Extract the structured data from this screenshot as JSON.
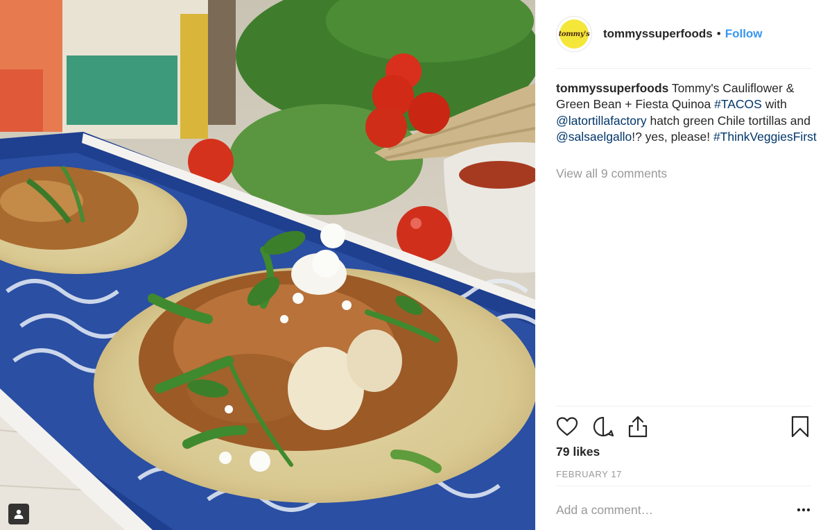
{
  "post": {
    "username": "tommyssuperfoods",
    "separator": "•",
    "follow_label": "Follow",
    "avatar_text": "tommy's",
    "caption": {
      "username": "tommyssuperfoods",
      "text_1": " Tommy's Cauliflower & Green Bean + Fiesta Quinoa ",
      "hashtag_1": "#TACOS",
      "text_2": " with ",
      "mention_1": "@latortillafactory",
      "text_3": " hatch green Chile tortillas and ",
      "mention_2": "@salsaelgallo",
      "text_4": "!? yes, please! ",
      "hashtag_2": "#ThinkVeggiesFirst"
    },
    "view_comments": "View all 9 comments",
    "likes": "79 likes",
    "date": "FEBRUARY 17",
    "comment_placeholder": "Add a comment…"
  },
  "icons": {
    "like": "heart-icon",
    "comment": "comment-icon",
    "share": "share-icon",
    "save": "bookmark-icon",
    "more": "more-options-icon",
    "tagged_people": "user-tag-icon"
  },
  "colors": {
    "accent": "#3897f0",
    "link": "#003569",
    "muted": "#999999",
    "text": "#262626"
  }
}
